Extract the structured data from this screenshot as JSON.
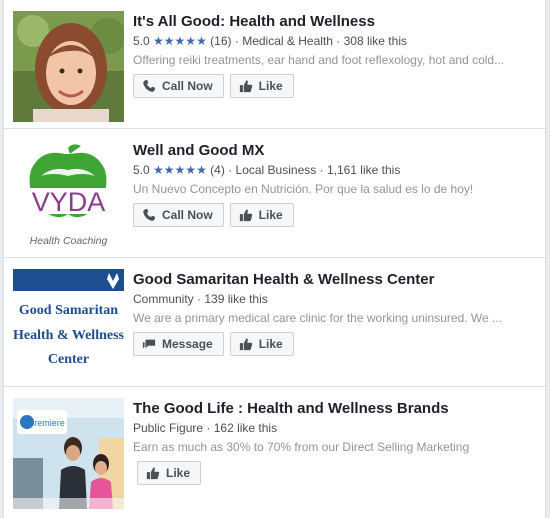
{
  "results": [
    {
      "title": "It's All Good: Health and Wellness",
      "rating": "5.0",
      "stars": "★★★★★",
      "reviews": "(16)",
      "category": "Medical & Health",
      "likes": "308 like this",
      "description": "Offering reiki treatments, ear hand and foot reflexology, hot and cold...",
      "primary_button": "Call Now",
      "primary_icon": "phone-icon",
      "like_button": "Like"
    },
    {
      "title": "Well and Good MX",
      "rating": "5.0",
      "stars": "★★★★★",
      "reviews": "(4)",
      "category": "Local Business",
      "likes": "1,161 like this",
      "description": "Un Nuevo Concepto en Nutrición. Por que la salud es lo de hoy!",
      "primary_button": "Call Now",
      "primary_icon": "phone-icon",
      "like_button": "Like",
      "logo_text": "VYDA",
      "logo_subtext": "Health Coaching"
    },
    {
      "title": "Good Samaritan Health & Wellness Center",
      "category": "Community",
      "likes": "139 like this",
      "description": "We are a primary medical care clinic for the working uninsured. We ...",
      "primary_button": "Message",
      "primary_icon": "message-icon",
      "like_button": "Like",
      "logo_lines": [
        "Good Samaritan",
        "Health & Wellness",
        "Center"
      ]
    },
    {
      "title": "The Good Life : Health and Wellness Brands",
      "category": "Public Figure",
      "likes": "162 like this",
      "description": "Earn as much as 30% to 70% from our Direct Selling Marketing",
      "like_button": "Like",
      "photo_sign": "premiere"
    }
  ],
  "colors": {
    "title": "#1d2129",
    "meta": "#4b4f56",
    "description": "#90949c",
    "stars": "#4267b2",
    "vyda_green": "#3fa535",
    "vyda_purple": "#8a3d8f",
    "samaritan_blue": "#1d4e8f"
  }
}
